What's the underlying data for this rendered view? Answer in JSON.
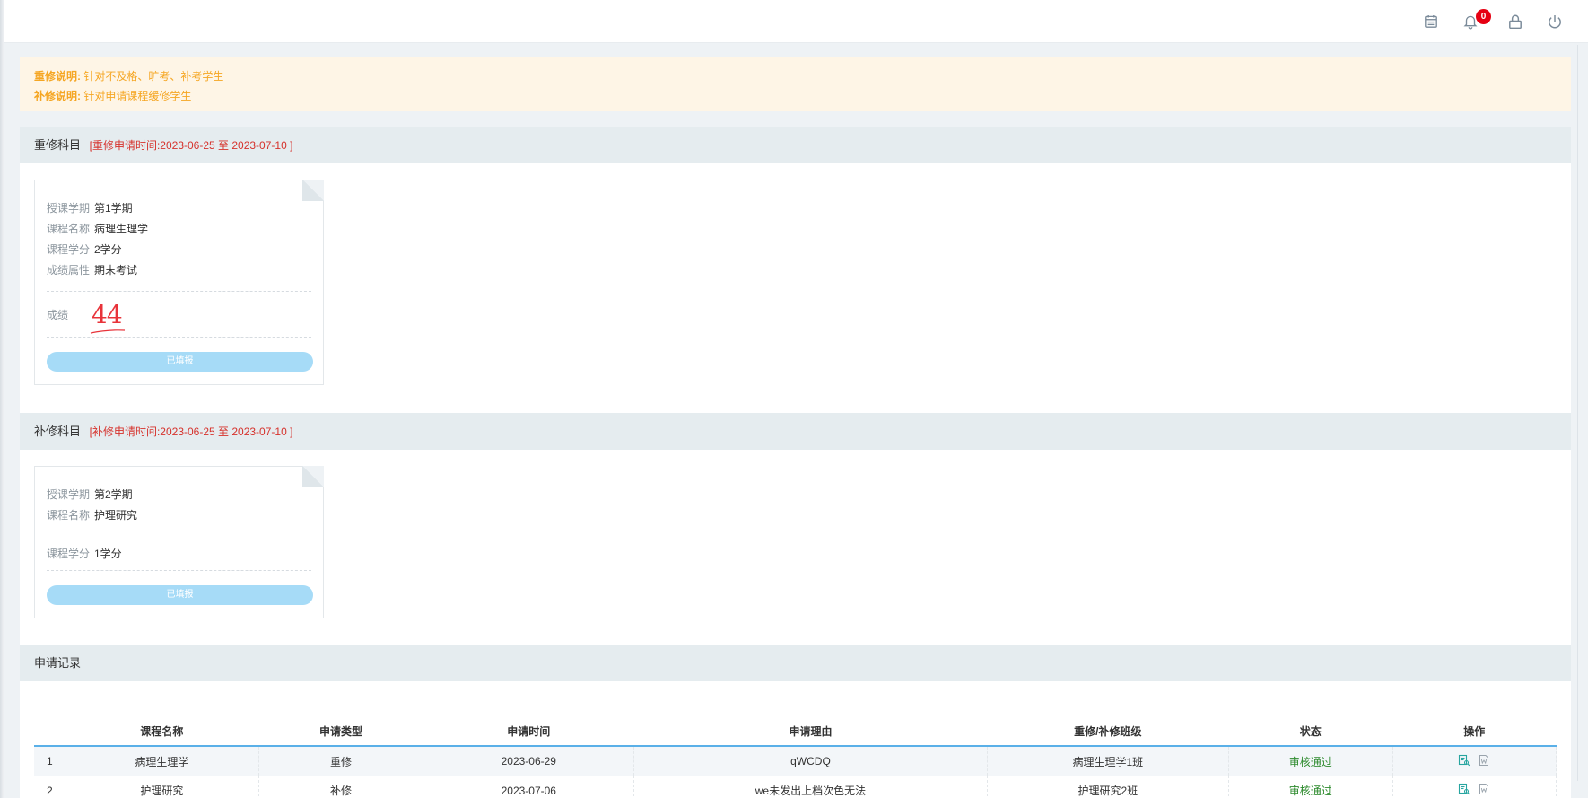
{
  "topbar": {
    "icons": [
      "calendar-icon",
      "bell-icon",
      "lock-icon",
      "power-icon"
    ],
    "notification_count": "0"
  },
  "notice": {
    "retake_key": "重修说明:",
    "retake_text": "针对不及格、旷考、补考学生",
    "makeup_key": "补修说明:",
    "makeup_text": "针对申请课程缓修学生"
  },
  "retake": {
    "title": "重修科目",
    "range": "[重修申请时间:2023-06-25   至 2023-07-10  ]",
    "card": {
      "term_label": "授课学期",
      "term": "第1学期",
      "course_label": "课程名称",
      "course": "病理生理学",
      "credit_label": "课程学分",
      "credit": "2学分",
      "attr_label": "成绩属性",
      "attr": "期末考试",
      "score_label": "成绩",
      "score": "44",
      "button": "已填报"
    }
  },
  "makeup": {
    "title": "补修科目",
    "range": "[补修申请时间:2023-06-25   至 2023-07-10  ]",
    "card": {
      "term_label": "授课学期",
      "term": "第2学期",
      "course_label": "课程名称",
      "course": "护理研究",
      "credit_label": "课程学分",
      "credit": "1学分",
      "button": "已填报"
    }
  },
  "records": {
    "title": "申请记录",
    "headers": [
      "",
      "课程名称",
      "申请类型",
      "申请时间",
      "申请理由",
      "重修/补修班级",
      "状态",
      "操作"
    ],
    "rows": [
      {
        "idx": "1",
        "course": "病理生理学",
        "type": "重修",
        "date": "2023-06-29",
        "reason": "qWCDQ",
        "class": "病理生理学1班",
        "status": "审核通过"
      },
      {
        "idx": "2",
        "course": "护理研究",
        "type": "补修",
        "date": "2023-07-06",
        "reason": "we未发出上档次色无法",
        "class": "护理研究2班",
        "status": "审核通过"
      }
    ]
  },
  "colors": {
    "accent_blue": "#5ab0e8",
    "notice_orange": "#f5a623",
    "range_red": "#d6322c",
    "status_green": "#2e8b2e",
    "button_disabled": "#a6dbf7"
  }
}
